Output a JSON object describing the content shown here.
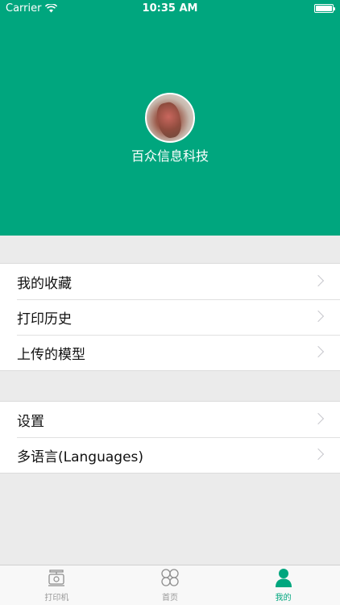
{
  "status_bar": {
    "carrier": "Carrier",
    "time": "10:35 AM"
  },
  "profile": {
    "username": "百众信息科技"
  },
  "menu_group_1": [
    {
      "label": "我的收藏"
    },
    {
      "label": "打印历史"
    },
    {
      "label": "上传的模型"
    }
  ],
  "menu_group_2": [
    {
      "label": "设置"
    },
    {
      "label": "多语言(Languages)"
    }
  ],
  "tabbar": {
    "tabs": [
      {
        "label": "打印机",
        "icon": "printer-icon",
        "active": false
      },
      {
        "label": "首页",
        "icon": "grid-icon",
        "active": false
      },
      {
        "label": "我的",
        "icon": "person-icon",
        "active": true
      }
    ]
  },
  "colors": {
    "accent": "#00a67e",
    "background": "#ebebeb",
    "inactive_tab": "#999999"
  }
}
